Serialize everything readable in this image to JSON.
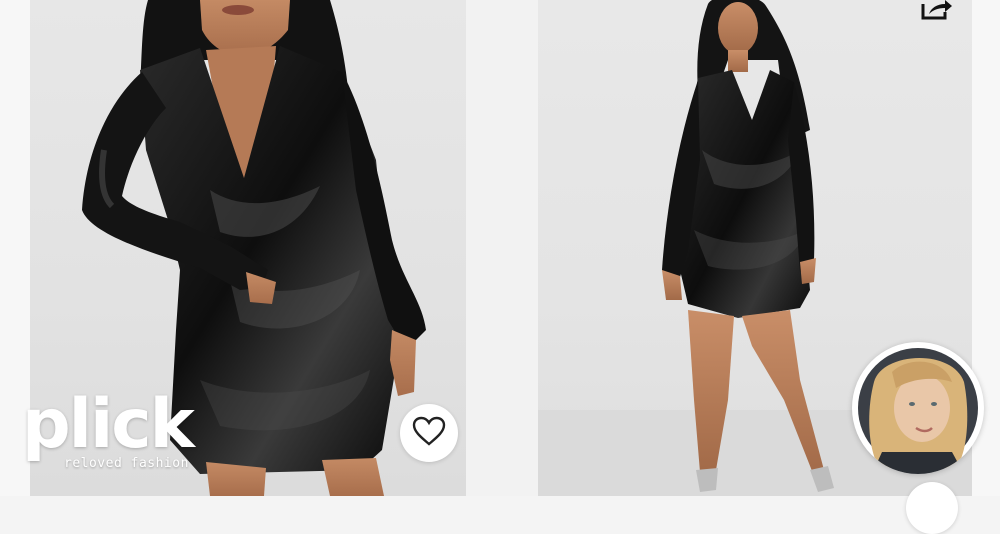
{
  "watermark": {
    "wordmark": "plick",
    "tagline": "reloved fashion"
  },
  "listings": [
    {
      "image": "model-in-black-satin-cowl-neck-shirt-dress-hand-on-hip",
      "like_icon": "heart-outline-icon"
    },
    {
      "image": "model-in-black-satin-cowl-neck-shirt-dress-full-length",
      "share_icon": "share-icon",
      "seller_avatar": "seller-profile-photo"
    }
  ],
  "colors": {
    "background": "#f4f4f4",
    "card_background": "#e4e4e4",
    "dress": "#141414",
    "button": "#ffffff"
  }
}
